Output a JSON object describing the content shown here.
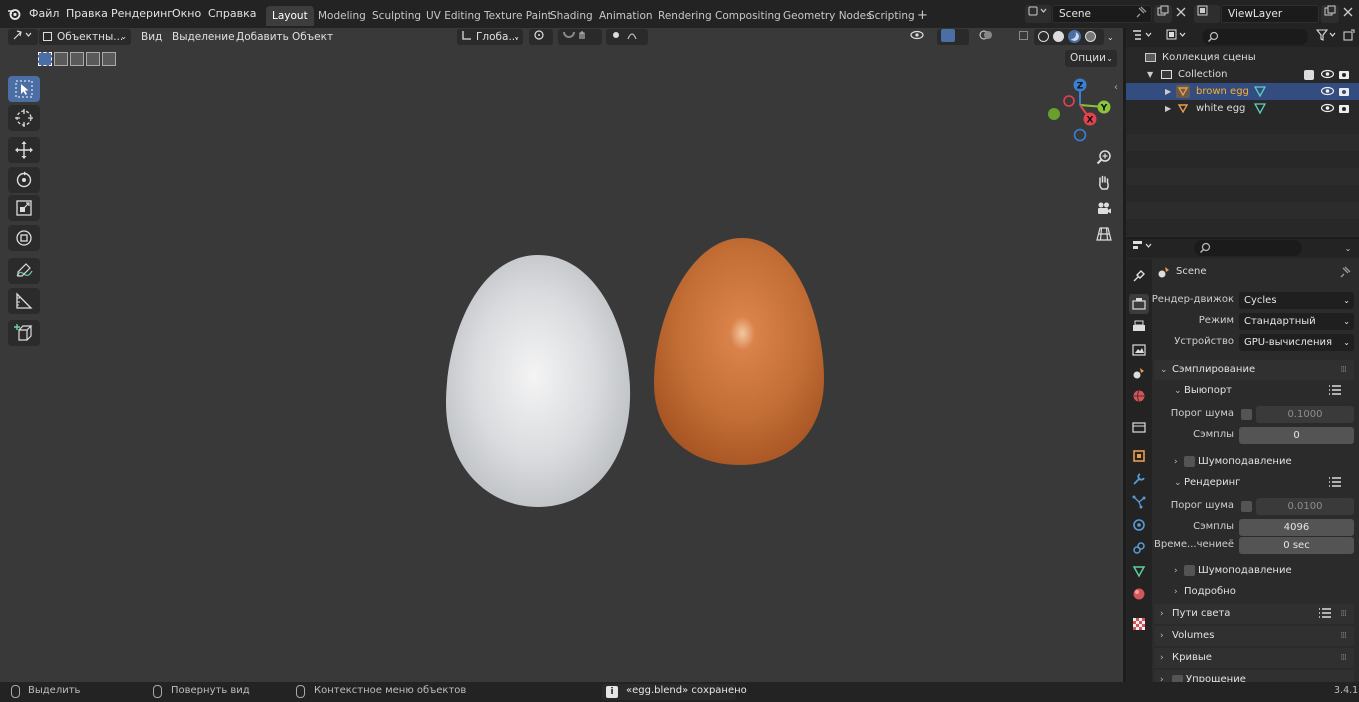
{
  "topbar": {
    "menus": [
      "Файл",
      "Правка",
      "Рендеринг",
      "Окно",
      "Справка"
    ],
    "workspaces": [
      "Layout",
      "Modeling",
      "Sculpting",
      "UV Editing",
      "Texture Paint",
      "Shading",
      "Animation",
      "Rendering",
      "Compositing",
      "Geometry Nodes",
      "Scripting"
    ],
    "active_workspace": "Layout",
    "add_workspace": "+",
    "scene_name": "Scene",
    "view_layer": "ViewLayer"
  },
  "viewport": {
    "mode": "Объектны...",
    "menus": [
      "Вид",
      "Выделение",
      "Добавить",
      "Объект"
    ],
    "transform_orientation": "Глоба...",
    "options_label": "Опции",
    "gizmo": {
      "z": "Z",
      "y": "Y",
      "x": "X"
    },
    "objects": [
      {
        "name": "white egg",
        "color": "#dcdee0"
      },
      {
        "name": "brown egg",
        "color": "#c26e35"
      }
    ]
  },
  "outliner": {
    "scene_collection": "Коллекция сцены",
    "collection": "Collection",
    "items": [
      {
        "name": "brown egg",
        "selected": true
      },
      {
        "name": "white egg",
        "selected": false
      }
    ]
  },
  "properties": {
    "scene_name": "Scene",
    "render_engine_label": "Рендер-движок",
    "render_engine": "Cycles",
    "mode_label": "Режим",
    "mode": "Стандартный",
    "device_label": "Устройство",
    "device": "GPU-вычисления",
    "sampling_title": "Сэмплирование",
    "viewport_title": "Выюпорт",
    "noise_threshold_label": "Порог шума",
    "viewport_noise_threshold": "0.1000",
    "samples_label": "Сэмплы",
    "viewport_samples": "0",
    "denoise_label": "Шумоподавление",
    "render_title": "Рендеринг",
    "render_noise_threshold": "0.0100",
    "render_samples": "4096",
    "time_limit_label": "Време...чениеё",
    "time_limit": "0 sec",
    "advanced_label": "Подробно",
    "panels": [
      "Пути света",
      "Volumes",
      "Кривые",
      "Упрощение"
    ]
  },
  "statusbar": {
    "select": "Выделить",
    "rotate_view": "Повернуть вид",
    "context_menu": "Контекстное меню объектов",
    "message": "«egg.blend» сохранено",
    "version": "3.4.1"
  },
  "colors": {
    "accent": "#4b6ea4",
    "selection_row": "#334d80",
    "viewport_bg": "#393939",
    "gizmo_x": "#e3434d",
    "gizmo_y": "#8bc43b",
    "gizmo_z": "#3b7fd3"
  }
}
